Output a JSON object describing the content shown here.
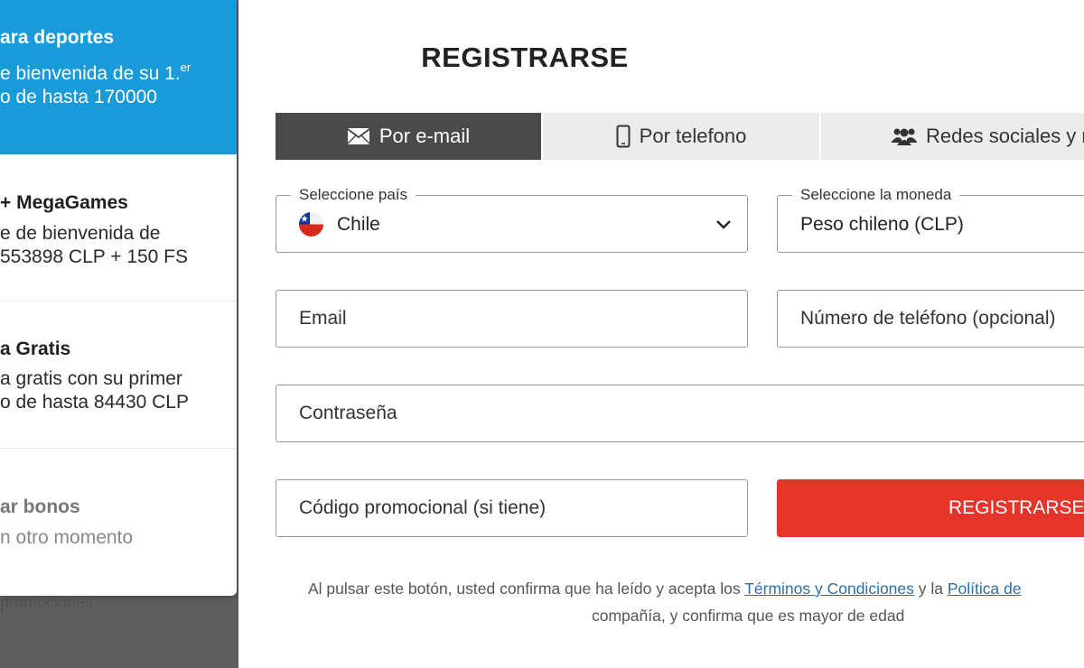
{
  "bonuses": [
    {
      "title": "ara deportes",
      "line1": "e bienvenida de su 1.",
      "line1_sup": "er",
      "line2": "o de hasta 170000"
    },
    {
      "title": "+ MegaGames",
      "line1": "e de bienvenida de",
      "line2": "553898 CLP + 150 FS"
    },
    {
      "title": "a Gratis",
      "line1": "a gratis con su primer",
      "line2": "o de hasta 84430 CLP"
    },
    {
      "title": "ar bonos",
      "line1": "n otro momento"
    }
  ],
  "background_hint": "promociones",
  "form": {
    "heading": "REGISTRARSE",
    "tabs": [
      {
        "label": "Por e-mail",
        "icon": "envelope-icon",
        "active": true
      },
      {
        "label": "Por telefono",
        "icon": "mobile-phone-icon",
        "active": false
      },
      {
        "label": "Redes sociales y m",
        "icon": "users-icon",
        "active": false
      }
    ],
    "country": {
      "legend": "Seleccione país",
      "value": "Chile",
      "icon": "chile-flag-icon"
    },
    "currency": {
      "legend": "Seleccione la moneda",
      "value": "Peso chileno (CLP)"
    },
    "email": {
      "placeholder": "Email"
    },
    "phone": {
      "placeholder": "Número de teléfono (opcional)"
    },
    "password": {
      "placeholder": "Contraseña"
    },
    "promo": {
      "placeholder": "Código promocional (si tiene)"
    },
    "submit_label": "REGISTRARSE"
  },
  "legal": {
    "part1": "Al pulsar este botón, usted confirma que ha leído y acepta los ",
    "terms_link": "Términos y Condiciones",
    "part2": " y la ",
    "privacy_link": "Política de",
    "line2": "compañía, y confirma que es mayor de edad"
  },
  "colors": {
    "accent_blue": "#1a9bd9",
    "submit_red": "#e5352b",
    "active_tab": "#4a4a4a"
  }
}
